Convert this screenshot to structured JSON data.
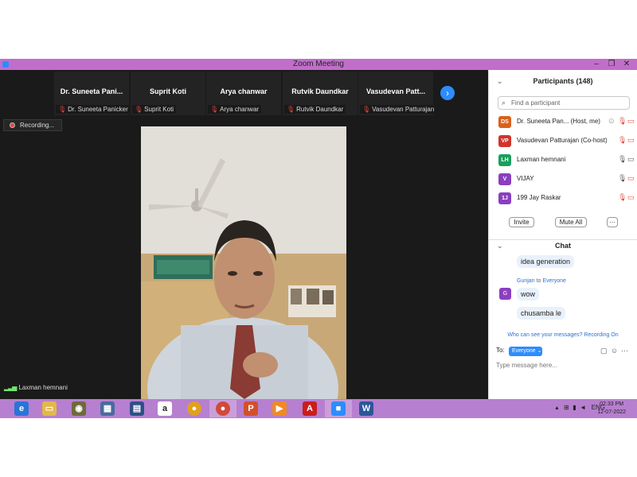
{
  "window": {
    "title": "Zoom Meeting",
    "minimize_glyph": "–",
    "restore_glyph": "❐",
    "close_glyph": "✕"
  },
  "gallery": {
    "thumbnails": [
      {
        "name": "Dr. Suneeta  Pani...",
        "label": "Dr. Suneeta Panicker"
      },
      {
        "name": "Suprit Koti",
        "label": "Suprit Koti"
      },
      {
        "name": "Arya chanwar",
        "label": "Arya chanwar"
      },
      {
        "name": "Rutvik Daundkar",
        "label": "Rutvik Daundkar"
      },
      {
        "name": "Vasudevan  Patt...",
        "label": "Vasudevan Patturajan"
      }
    ],
    "next_glyph": "›"
  },
  "recording": {
    "label": "Recording..."
  },
  "active_speaker": {
    "label": "Laxman hemnani"
  },
  "participants": {
    "title": "Participants (148)",
    "search_placeholder": "Find a participant",
    "list": [
      {
        "initials": "DS",
        "color": "#d9601c",
        "name": "Dr. Suneeta Pan... (Host, me)"
      },
      {
        "initials": "VP",
        "color": "#d0342c",
        "name": "Vasudevan Patturajan (Co-host)"
      },
      {
        "initials": "LH",
        "color": "#17a05d",
        "name": "Laxman hemnani"
      },
      {
        "initials": "V",
        "color": "#8a3fc0",
        "name": "VIJAY"
      },
      {
        "initials": "1J",
        "color": "#8a3fc0",
        "name": "199 Jay Raskar"
      }
    ],
    "invite_label": "Invite",
    "mute_all_label": "Mute All",
    "more_label": "···"
  },
  "chat": {
    "title": "Chat",
    "messages": [
      {
        "text": "idea generation"
      },
      {
        "sender": "Gunjan",
        "to": "to",
        "recipient": "Everyone",
        "avatar": "G",
        "text": "wow"
      },
      {
        "text": "chusamba le"
      }
    ],
    "notice": "Who can see your messages? Recording On",
    "to_label": "To:",
    "to_value": "Everyone ⌄",
    "input_placeholder": "Type message here..."
  },
  "taskbar": {
    "lang": "ENG",
    "time": "02:33 PM",
    "date": "12-07-2022"
  }
}
